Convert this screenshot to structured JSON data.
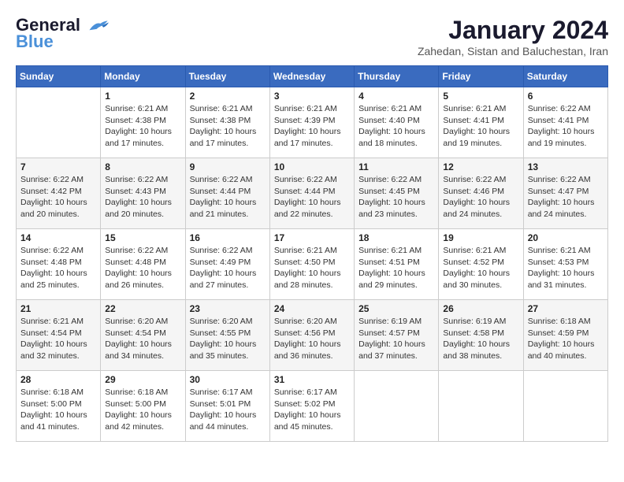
{
  "header": {
    "logo_line1": "General",
    "logo_line2": "Blue",
    "month_year": "January 2024",
    "location": "Zahedan, Sistan and Baluchestan, Iran"
  },
  "weekdays": [
    "Sunday",
    "Monday",
    "Tuesday",
    "Wednesday",
    "Thursday",
    "Friday",
    "Saturday"
  ],
  "weeks": [
    [
      {
        "day": "",
        "info": ""
      },
      {
        "day": "1",
        "info": "Sunrise: 6:21 AM\nSunset: 4:38 PM\nDaylight: 10 hours\nand 17 minutes."
      },
      {
        "day": "2",
        "info": "Sunrise: 6:21 AM\nSunset: 4:38 PM\nDaylight: 10 hours\nand 17 minutes."
      },
      {
        "day": "3",
        "info": "Sunrise: 6:21 AM\nSunset: 4:39 PM\nDaylight: 10 hours\nand 17 minutes."
      },
      {
        "day": "4",
        "info": "Sunrise: 6:21 AM\nSunset: 4:40 PM\nDaylight: 10 hours\nand 18 minutes."
      },
      {
        "day": "5",
        "info": "Sunrise: 6:21 AM\nSunset: 4:41 PM\nDaylight: 10 hours\nand 19 minutes."
      },
      {
        "day": "6",
        "info": "Sunrise: 6:22 AM\nSunset: 4:41 PM\nDaylight: 10 hours\nand 19 minutes."
      }
    ],
    [
      {
        "day": "7",
        "info": "Sunrise: 6:22 AM\nSunset: 4:42 PM\nDaylight: 10 hours\nand 20 minutes."
      },
      {
        "day": "8",
        "info": "Sunrise: 6:22 AM\nSunset: 4:43 PM\nDaylight: 10 hours\nand 20 minutes."
      },
      {
        "day": "9",
        "info": "Sunrise: 6:22 AM\nSunset: 4:44 PM\nDaylight: 10 hours\nand 21 minutes."
      },
      {
        "day": "10",
        "info": "Sunrise: 6:22 AM\nSunset: 4:44 PM\nDaylight: 10 hours\nand 22 minutes."
      },
      {
        "day": "11",
        "info": "Sunrise: 6:22 AM\nSunset: 4:45 PM\nDaylight: 10 hours\nand 23 minutes."
      },
      {
        "day": "12",
        "info": "Sunrise: 6:22 AM\nSunset: 4:46 PM\nDaylight: 10 hours\nand 24 minutes."
      },
      {
        "day": "13",
        "info": "Sunrise: 6:22 AM\nSunset: 4:47 PM\nDaylight: 10 hours\nand 24 minutes."
      }
    ],
    [
      {
        "day": "14",
        "info": "Sunrise: 6:22 AM\nSunset: 4:48 PM\nDaylight: 10 hours\nand 25 minutes."
      },
      {
        "day": "15",
        "info": "Sunrise: 6:22 AM\nSunset: 4:48 PM\nDaylight: 10 hours\nand 26 minutes."
      },
      {
        "day": "16",
        "info": "Sunrise: 6:22 AM\nSunset: 4:49 PM\nDaylight: 10 hours\nand 27 minutes."
      },
      {
        "day": "17",
        "info": "Sunrise: 6:21 AM\nSunset: 4:50 PM\nDaylight: 10 hours\nand 28 minutes."
      },
      {
        "day": "18",
        "info": "Sunrise: 6:21 AM\nSunset: 4:51 PM\nDaylight: 10 hours\nand 29 minutes."
      },
      {
        "day": "19",
        "info": "Sunrise: 6:21 AM\nSunset: 4:52 PM\nDaylight: 10 hours\nand 30 minutes."
      },
      {
        "day": "20",
        "info": "Sunrise: 6:21 AM\nSunset: 4:53 PM\nDaylight: 10 hours\nand 31 minutes."
      }
    ],
    [
      {
        "day": "21",
        "info": "Sunrise: 6:21 AM\nSunset: 4:54 PM\nDaylight: 10 hours\nand 32 minutes."
      },
      {
        "day": "22",
        "info": "Sunrise: 6:20 AM\nSunset: 4:54 PM\nDaylight: 10 hours\nand 34 minutes."
      },
      {
        "day": "23",
        "info": "Sunrise: 6:20 AM\nSunset: 4:55 PM\nDaylight: 10 hours\nand 35 minutes."
      },
      {
        "day": "24",
        "info": "Sunrise: 6:20 AM\nSunset: 4:56 PM\nDaylight: 10 hours\nand 36 minutes."
      },
      {
        "day": "25",
        "info": "Sunrise: 6:19 AM\nSunset: 4:57 PM\nDaylight: 10 hours\nand 37 minutes."
      },
      {
        "day": "26",
        "info": "Sunrise: 6:19 AM\nSunset: 4:58 PM\nDaylight: 10 hours\nand 38 minutes."
      },
      {
        "day": "27",
        "info": "Sunrise: 6:18 AM\nSunset: 4:59 PM\nDaylight: 10 hours\nand 40 minutes."
      }
    ],
    [
      {
        "day": "28",
        "info": "Sunrise: 6:18 AM\nSunset: 5:00 PM\nDaylight: 10 hours\nand 41 minutes."
      },
      {
        "day": "29",
        "info": "Sunrise: 6:18 AM\nSunset: 5:00 PM\nDaylight: 10 hours\nand 42 minutes."
      },
      {
        "day": "30",
        "info": "Sunrise: 6:17 AM\nSunset: 5:01 PM\nDaylight: 10 hours\nand 44 minutes."
      },
      {
        "day": "31",
        "info": "Sunrise: 6:17 AM\nSunset: 5:02 PM\nDaylight: 10 hours\nand 45 minutes."
      },
      {
        "day": "",
        "info": ""
      },
      {
        "day": "",
        "info": ""
      },
      {
        "day": "",
        "info": ""
      }
    ]
  ]
}
